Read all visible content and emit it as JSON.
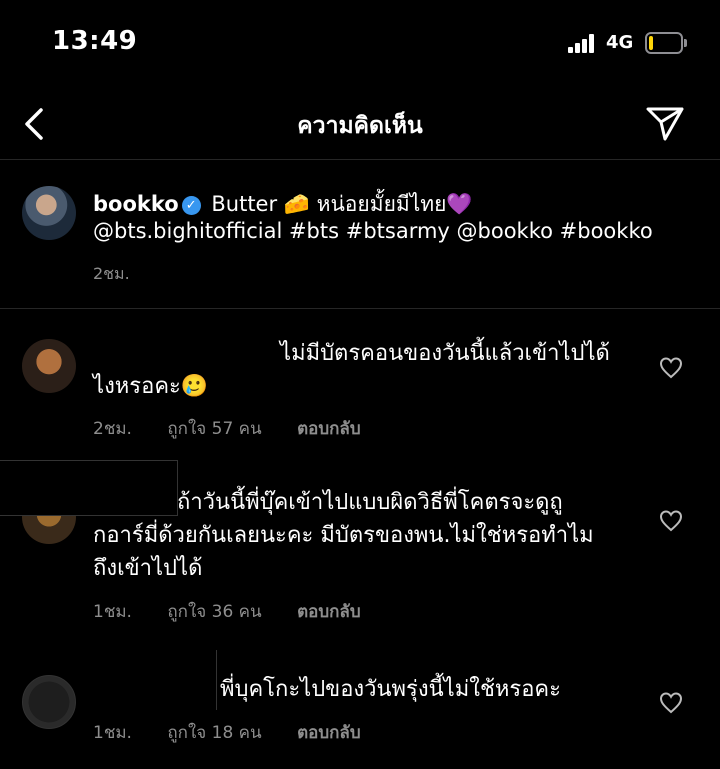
{
  "status_bar": {
    "time": "13:49",
    "network": "4G",
    "battery_level": 0.12,
    "battery_color": "#ffd60a"
  },
  "nav": {
    "back_icon": "chevron-left-icon",
    "title": "ความคิดเห็น",
    "send_icon": "paper-plane-icon"
  },
  "caption": {
    "username": "bookko",
    "verified": true,
    "text_line1": "Butter 🧀 หน่อยมั้ยมีไทย💜",
    "text_line2": "@bts.bighitofficial #bts #btsarmy @bookko #bookko",
    "time": "2ชม."
  },
  "comments": [
    {
      "line1": "ไม่มีบัตรคอนของวันนี้แล้วเข้าไปได้",
      "line2": "ไงหรอคะ🥲",
      "time": "2ชม.",
      "likes": "ถูกใจ 57 คน",
      "reply": "ตอบกลับ"
    },
    {
      "line1": "ถ้าวันนี้พี่บุ๊คเข้าไปแบบผิดวิธีพี่โคตรจะดูถู",
      "line2": "กอาร์มี่ด้วยกันเลยนะคะ มีบัตรของพน.ไม่ใช่หรอทำไม",
      "line3": "ถึงเข้าไปได้",
      "time": "1ชม.",
      "likes": "ถูกใจ 36 คน",
      "reply": "ตอบกลับ"
    },
    {
      "line1": "พี่บุคโกะไปของวันพรุ่งนี้ไม่ใช้หรอคะ",
      "time": "1ชม.",
      "likes": "ถูกใจ 18 คน",
      "reply": "ตอบกลับ"
    }
  ]
}
